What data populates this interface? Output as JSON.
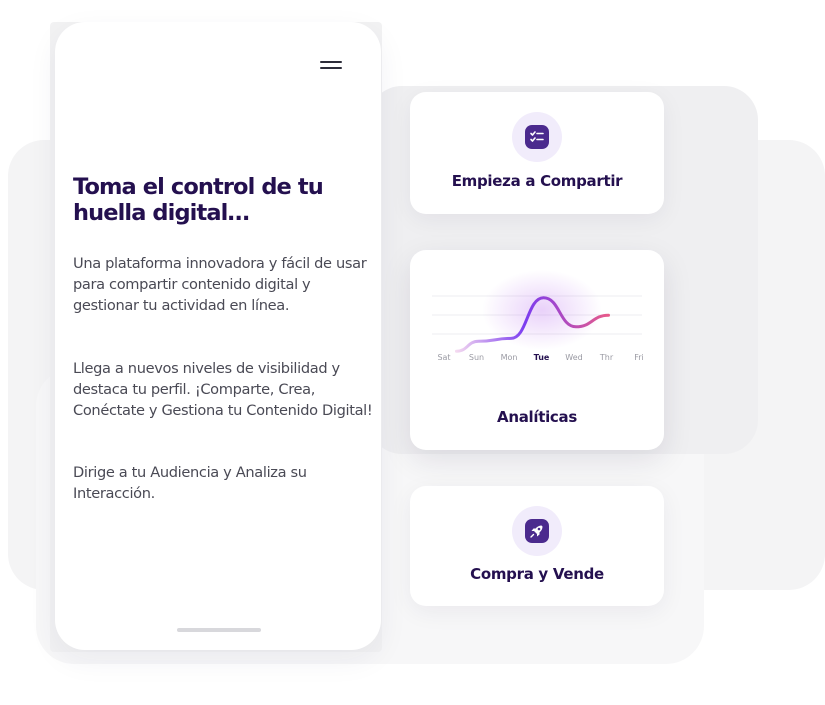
{
  "phone": {
    "menu_icon": "hamburger-menu-icon",
    "title": "Toma el control de tu huella digital…",
    "paragraphs": [
      "Una plataforma innovadora y fácil de usar para compartir contenido digital y gestionar tu actividad en línea.",
      "Llega a nuevos niveles de visibilidad y destaca tu perfil. ¡Comparte, Crea, Conéctate y Gestiona tu Contenido Digital!",
      "Dirige a tu Audiencia y Analiza su Interacción."
    ]
  },
  "cards": {
    "share": {
      "label": "Empieza a Compartir",
      "icon": "checklist-icon"
    },
    "analytics": {
      "label": "Analíticas",
      "icon": "line-chart"
    },
    "sell": {
      "label": "Compra y Vende",
      "icon": "rocket-icon"
    }
  },
  "chart_data": {
    "type": "line",
    "x": [
      "Sat",
      "Sun",
      "Mon",
      "Tue",
      "Wed",
      "Thr",
      "Fri"
    ],
    "highlighted": "Tue",
    "series": [
      {
        "values": [
          null,
          0.15,
          0.2,
          0.9,
          0.4,
          0.6,
          null
        ]
      }
    ],
    "ylim": [
      0,
      1
    ],
    "grid": true
  },
  "colors": {
    "brand_dark": "#24104f",
    "accent_purple": "#4b2a8e",
    "gradient_start": "#7b3cf0",
    "gradient_end": "#e85a8a"
  }
}
